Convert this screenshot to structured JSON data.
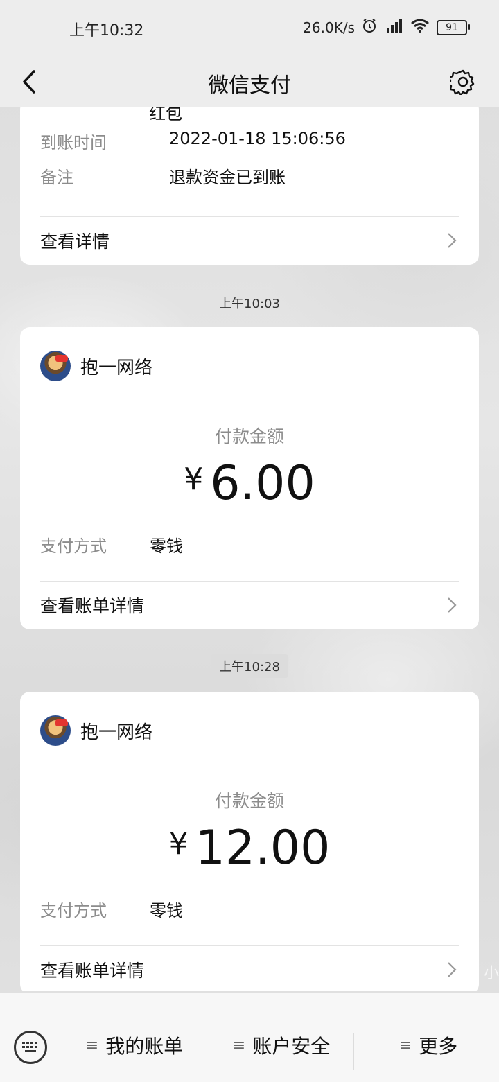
{
  "status_bar": {
    "time": "上午10:32",
    "net_speed": "26.0K/s",
    "battery": "91"
  },
  "header": {
    "title": "微信支付"
  },
  "card1": {
    "partial_value": "红包",
    "arrival_time_label": "到账时间",
    "arrival_time_value": "2022-01-18  15:06:56",
    "remark_label": "备注",
    "remark_value": "退款资金已到账",
    "link": "查看详情"
  },
  "msg1": {
    "timestamp": "上午10:03",
    "merchant": "抱一网络",
    "amount_label": "付款金额",
    "currency": "¥",
    "amount": "6.00",
    "method_label": "支付方式",
    "method_value": "零钱",
    "link": "查看账单详情"
  },
  "msg2": {
    "timestamp": "上午10:28",
    "merchant": "抱一网络",
    "amount_label": "付款金额",
    "currency": "¥",
    "amount": "12.00",
    "method_label": "支付方式",
    "method_value": "零钱",
    "link": "查看账单详情"
  },
  "watermark": "小",
  "bottom_menu": {
    "items": [
      {
        "label": "我的账单"
      },
      {
        "label": "账户安全"
      },
      {
        "label": "更多"
      }
    ]
  }
}
